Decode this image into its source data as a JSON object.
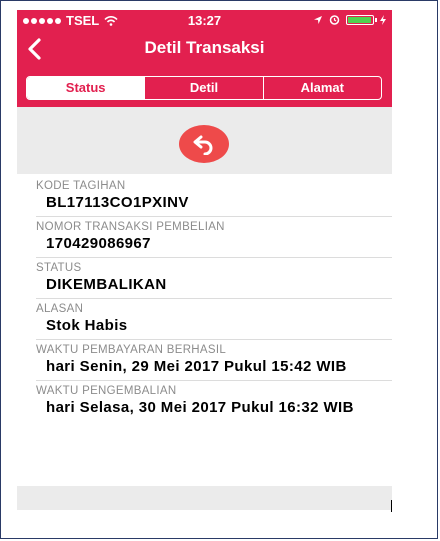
{
  "status_bar": {
    "carrier": "TSEL",
    "time": "13:27",
    "icons": [
      "signal-dots-icon",
      "wifi-icon",
      "location-arrow-icon",
      "alarm-icon",
      "battery-icon",
      "charging-icon"
    ],
    "battery_color": "#4fd14f"
  },
  "nav": {
    "title": "Detil Transaksi",
    "back_icon": "chevron-left-icon"
  },
  "tabs": [
    {
      "label": "Status",
      "active": true
    },
    {
      "label": "Detil",
      "active": false
    },
    {
      "label": "Alamat",
      "active": false
    }
  ],
  "action": {
    "icon": "undo-arrow-icon",
    "color": "#ee4a4a"
  },
  "details": [
    {
      "label": "KODE TAGIHAN",
      "value": "BL17113CO1PXINV"
    },
    {
      "label": "NOMOR TRANSAKSI PEMBELIAN",
      "value": "170429086967"
    },
    {
      "label": "STATUS",
      "value": "DIKEMBALIKAN"
    },
    {
      "label": "ALASAN",
      "value": "Stok Habis"
    },
    {
      "label": "WAKTU PEMBAYARAN BERHASIL",
      "value": "hari Senin, 29 Mei 2017 Pukul 15:42 WIB"
    },
    {
      "label": "WAKTU PENGEMBALIAN",
      "value": "hari Selasa, 30 Mei 2017 Pukul 16:32 WIB"
    }
  ],
  "colors": {
    "brand": "#e2204f",
    "background": "#ebebeb"
  }
}
